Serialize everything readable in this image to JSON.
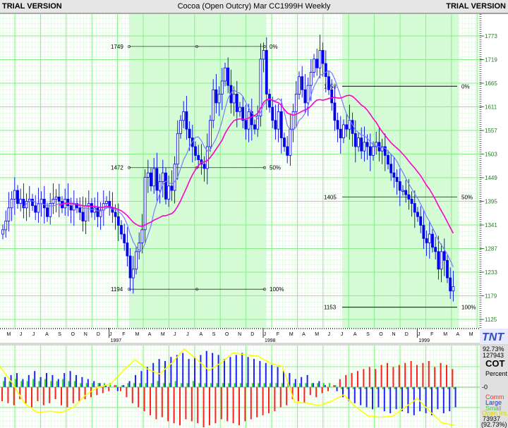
{
  "header": {
    "left": "TRIAL VERSION",
    "title": "Cocoa (Open Outcry) Mar CC1999H Weekly",
    "right": "TRIAL VERSION"
  },
  "logo": "TNT",
  "colors": {
    "candle": "#0000ee",
    "ma_fast": "#7a7aff",
    "ma_slow": "#ff00cc",
    "grid_major": "#86ef86",
    "grid_minor": "#d9fbd9",
    "fib_zone": "#d4fcd4",
    "comm": "#ff2020",
    "large": "#2020ff",
    "small": "#20dd20",
    "open_int": "#ffff00",
    "axis_text": "#208020"
  },
  "chart_data": [
    {
      "type": "candlestick",
      "title": "Cocoa (Open Outcry) Mar CC1999H Weekly",
      "y_ticks": [
        1773,
        1719,
        1665,
        1611,
        1557,
        1503,
        1449,
        1395,
        1341,
        1287,
        1233,
        1179,
        1125
      ],
      "ylim": [
        1105,
        1800
      ],
      "x_month_labels": [
        "M",
        "J",
        "J",
        "A",
        "S",
        "O",
        "N",
        "D",
        "J",
        "F",
        "M",
        "A",
        "M",
        "J",
        "J",
        "A",
        "S",
        "O",
        "N",
        "D",
        "J",
        "F",
        "M",
        "A",
        "M",
        "J",
        "J",
        "A",
        "S",
        "O",
        "N",
        "D",
        "J",
        "F",
        "M",
        "A",
        "M"
      ],
      "x_year_labels": [
        "1997",
        "1998",
        "1999"
      ],
      "weekly_close": [
        1330,
        1350,
        1380,
        1400,
        1420,
        1390,
        1400,
        1380,
        1395,
        1400,
        1385,
        1370,
        1390,
        1400,
        1380,
        1360,
        1390,
        1400,
        1405,
        1395,
        1380,
        1400,
        1385,
        1375,
        1390,
        1380,
        1370,
        1350,
        1385,
        1390,
        1370,
        1380,
        1360,
        1375,
        1390,
        1395,
        1380,
        1370,
        1360,
        1340,
        1320,
        1300,
        1270,
        1220,
        1240,
        1280,
        1300,
        1330,
        1450,
        1460,
        1430,
        1470,
        1420,
        1440,
        1460,
        1400,
        1430,
        1420,
        1480,
        1550,
        1580,
        1600,
        1560,
        1540,
        1520,
        1500,
        1490,
        1480,
        1470,
        1520,
        1580,
        1650,
        1620,
        1640,
        1670,
        1700,
        1660,
        1620,
        1640,
        1600,
        1610,
        1580,
        1560,
        1600,
        1570,
        1560,
        1590,
        1720,
        1740,
        1640,
        1610,
        1580,
        1560,
        1600,
        1540,
        1520,
        1500,
        1560,
        1600,
        1640,
        1680,
        1650,
        1620,
        1660,
        1690,
        1720,
        1700,
        1740,
        1710,
        1680,
        1650,
        1620,
        1580,
        1560,
        1540,
        1570,
        1560,
        1580,
        1550,
        1520,
        1540,
        1510,
        1530,
        1520,
        1500,
        1520,
        1530,
        1510,
        1520,
        1500,
        1480,
        1460,
        1450,
        1440,
        1420,
        1420,
        1410,
        1400,
        1390,
        1370,
        1360,
        1340,
        1310,
        1300,
        1320,
        1290,
        1280,
        1240,
        1280,
        1260,
        1220,
        1190,
        1200
      ],
      "moving_averages": [
        {
          "name": "fast",
          "period": 8
        },
        {
          "name": "slow",
          "period": 20
        }
      ],
      "fib_retracements": [
        {
          "levels": [
            {
              "price": "1749",
              "pct": "0%"
            },
            {
              "price": "1472",
              "pct": "50%"
            },
            {
              "price": "1194",
              "pct": "100%"
            }
          ],
          "values": [
            1749,
            1472,
            1194
          ]
        },
        {
          "levels": [
            {
              "price": "1658",
              "pct": "0%"
            },
            {
              "price": "1405",
              "pct": "50%"
            },
            {
              "price": "1153",
              "pct": "100%"
            }
          ],
          "values": [
            1658,
            1405,
            1153
          ]
        }
      ]
    },
    {
      "type": "bar",
      "title": "COT",
      "unit": "Percent",
      "zero_label": "0",
      "top_label": "92.73%",
      "top_value": "127943",
      "bottom_value": "73937",
      "bottom_label": "(92.73%)",
      "ylim": [
        -100,
        100
      ],
      "legend": [
        "Comm",
        "Large",
        "Small",
        "Open Int."
      ],
      "comm": [
        -35,
        -40,
        -45,
        -30,
        -40,
        -50,
        -35,
        -45,
        -40,
        -30,
        -45,
        -50,
        -40,
        -35,
        -30,
        -25,
        -20,
        -15,
        -10,
        5,
        -10,
        -25,
        -40,
        -50,
        -60,
        -70,
        -80,
        -75,
        -85,
        -90,
        -95,
        -80,
        -85,
        -90,
        -100,
        -95,
        -90,
        -80,
        -85,
        -90,
        -95,
        -85,
        -80,
        -75,
        -70,
        -65,
        -60,
        -50,
        -45,
        -30,
        -35,
        -40,
        -20,
        -25,
        -15,
        -10,
        5,
        20,
        30,
        35,
        40,
        45,
        50,
        45,
        55,
        60,
        50,
        55,
        60,
        65,
        55,
        60,
        65,
        50,
        60,
        55,
        45
      ],
      "large": [
        25,
        30,
        35,
        20,
        30,
        40,
        25,
        35,
        30,
        20,
        35,
        40,
        30,
        25,
        20,
        15,
        10,
        5,
        0,
        -10,
        5,
        15,
        30,
        40,
        50,
        60,
        70,
        65,
        75,
        80,
        85,
        70,
        75,
        80,
        90,
        85,
        80,
        70,
        75,
        80,
        85,
        75,
        70,
        65,
        60,
        55,
        50,
        40,
        35,
        20,
        25,
        30,
        10,
        15,
        5,
        0,
        -10,
        -25,
        -35,
        -40,
        -45,
        -50,
        -55,
        -50,
        -60,
        -65,
        -55,
        -60,
        -65,
        -70,
        -60,
        -65,
        -70,
        -55,
        -65,
        -60,
        -50
      ],
      "small": [
        15,
        15,
        20,
        15,
        15,
        20,
        15,
        20,
        15,
        15,
        20,
        15,
        15,
        10,
        10,
        10,
        10,
        10,
        10,
        5,
        5,
        10,
        10,
        10,
        10,
        10,
        15,
        10,
        10,
        15,
        10,
        10,
        15,
        10,
        10,
        10,
        10,
        10,
        10,
        10,
        10,
        10,
        10,
        10,
        10,
        10,
        10,
        10,
        10,
        10,
        10,
        10,
        10,
        10,
        10,
        10,
        5,
        -5,
        -5,
        -5,
        -5,
        -5,
        -5,
        -5,
        -5,
        -5,
        -5,
        -5,
        -5,
        -5,
        -5,
        -5,
        -5,
        -5,
        -5,
        -5,
        -5
      ],
      "open_int": [
        51,
        10,
        -40,
        -63,
        -60,
        -63,
        -50,
        -19,
        0,
        7,
        40,
        68,
        45,
        33,
        60,
        95,
        70,
        42,
        60,
        86,
        80,
        77,
        60,
        51,
        -37,
        -40,
        -46,
        -35,
        -19,
        -50,
        -72,
        -75,
        -72,
        -50,
        -28,
        -60,
        -89,
        -95
      ]
    }
  ]
}
